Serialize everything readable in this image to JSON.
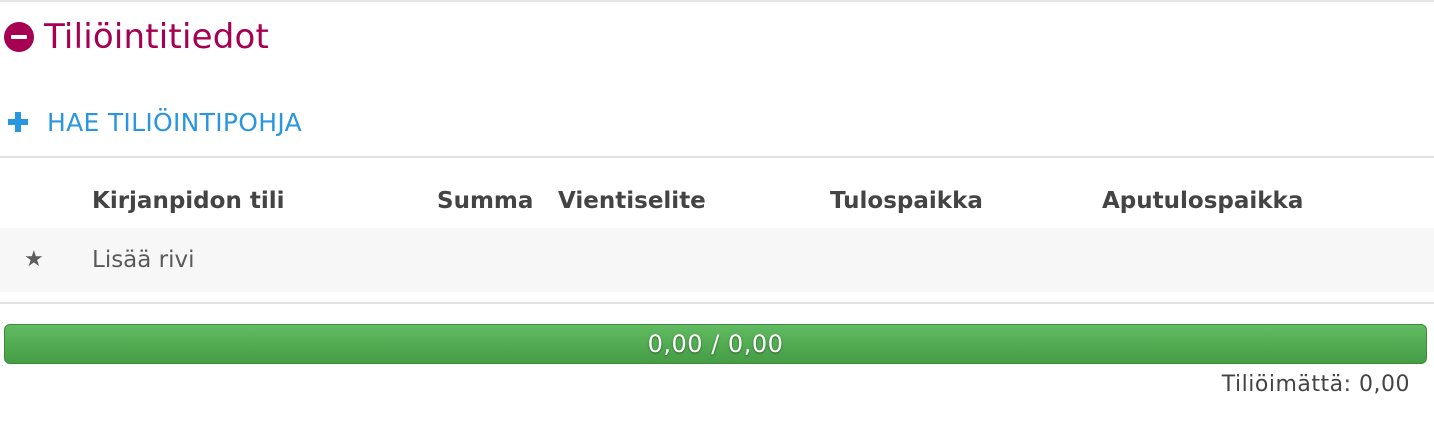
{
  "section": {
    "title": "Tiliöintitiedot",
    "collapse_icon": "minus-circle-icon",
    "accent_color": "#a50052"
  },
  "template_action": {
    "label": "HAE TILIÖINTIPOHJA",
    "icon": "plus-icon",
    "color": "#2b96e0"
  },
  "table": {
    "columns": [
      "Kirjanpidon tili",
      "Summa",
      "Vientiselite",
      "Tulospaikka",
      "Aputulospaikka"
    ],
    "add_row": {
      "icon": "star-icon",
      "label": "Lisää rivi"
    }
  },
  "progress": {
    "text": "0,00 / 0,00",
    "fraction": 1.0,
    "color": "#52ac52"
  },
  "remaining": {
    "text": "Tiliöimättä: 0,00"
  }
}
